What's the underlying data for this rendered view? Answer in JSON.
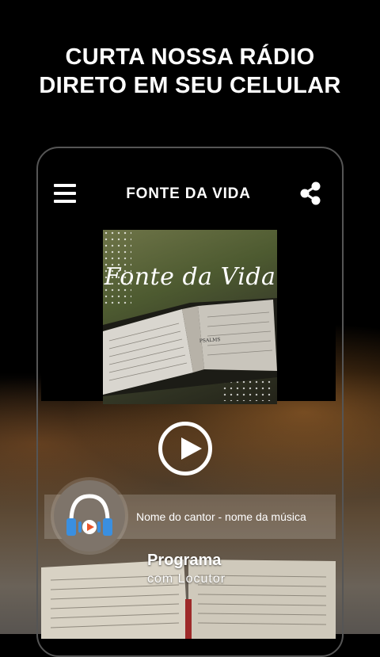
{
  "promo": {
    "line1": "CURTA NOSSA RÁDIO",
    "line2": "DIRETO EM SEU CELULAR"
  },
  "app": {
    "title": "FONTE DA VIDA",
    "menu_icon": "hamburger-menu-icon",
    "share_icon": "share-icon"
  },
  "album": {
    "script_title": "Fonte da Vida",
    "book_heading": "PSALMS"
  },
  "player": {
    "play_icon": "play-icon",
    "now_playing": "Nome do cantor - nome da música",
    "program_title": "Programa",
    "program_host": "com Locutor"
  },
  "colors": {
    "headphone_blue": "#3a8fe0",
    "play_orange": "#e8542a",
    "background": "#000000"
  }
}
